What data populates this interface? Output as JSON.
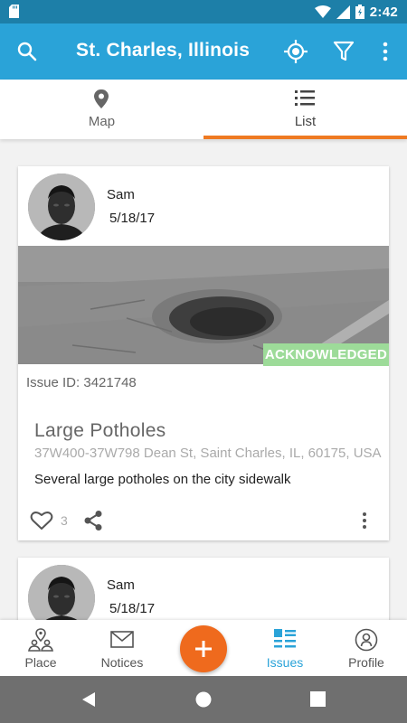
{
  "status_bar": {
    "time": "2:42"
  },
  "app_bar": {
    "title": "St. Charles, Illinois"
  },
  "tabs": [
    {
      "label": "Map",
      "icon": "map-pin-icon",
      "active": false
    },
    {
      "label": "List",
      "icon": "list-icon",
      "active": true
    }
  ],
  "issues": [
    {
      "author": "Sam",
      "date": "5/18/17",
      "status": "ACKNOWLEDGED",
      "issue_id": "Issue ID: 3421748",
      "title": "Large Potholes",
      "address": "37W400-37W798 Dean St, Saint Charles, IL, 60175, USA",
      "description": "Several large potholes on the city sidewalk",
      "likes": "3"
    },
    {
      "author": "Sam",
      "date": "5/18/17"
    }
  ],
  "bottom_nav": {
    "items": [
      {
        "label": "Place",
        "icon": "place-icon"
      },
      {
        "label": "Notices",
        "icon": "mail-icon"
      },
      {
        "label": "Issues",
        "icon": "issues-icon"
      },
      {
        "label": "Profile",
        "icon": "profile-icon"
      }
    ],
    "active": "Issues"
  },
  "colors": {
    "status_bar": "#1d7fa8",
    "app_bar": "#2aa3d8",
    "accent": "#ef7a22",
    "fab": "#ef6a1d",
    "badge": "#9ddb99",
    "active_nav": "#2aa3d8"
  }
}
